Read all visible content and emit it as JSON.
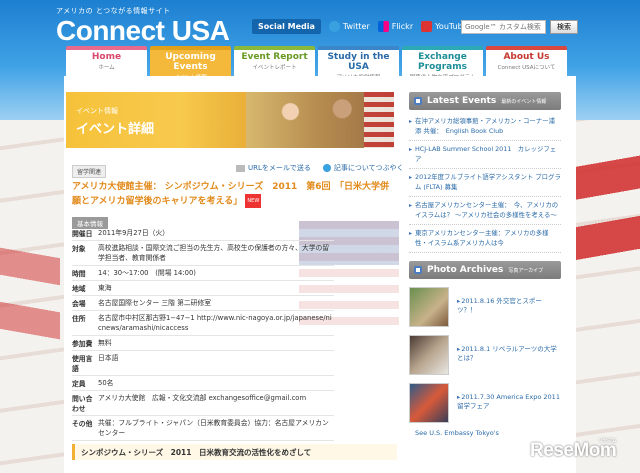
{
  "header": {
    "tagline": "アメリカの   とつながる情報サイト",
    "logo": "Connect USA"
  },
  "social": {
    "label": "Social Media",
    "twitter": "Twitter",
    "flickr": "Flickr",
    "youtube": "YouTube"
  },
  "search": {
    "placeholder": "Google™ カスタム検索",
    "button": "検索"
  },
  "nav": [
    {
      "title": "Home",
      "sub": "ホーム"
    },
    {
      "title": "Upcoming Events",
      "sub": "イベント情報"
    },
    {
      "title": "Event Report",
      "sub": "イベントレポート"
    },
    {
      "title": "Study in the USA",
      "sub": "アメリカ留学情報"
    },
    {
      "title": "Exchange Programs",
      "sub": "国務省人物交流プログラム"
    },
    {
      "title": "About Us",
      "sub": "Connect USAについて"
    }
  ],
  "banner": {
    "small": "イベント情報",
    "big": "イベント詳細"
  },
  "share": {
    "mail": "URLをメールで送る",
    "tweet": "記事についてつぶやく"
  },
  "article": {
    "category": "留学関連",
    "title": "アメリカ大使館主催： シンポジウム・シリーズ　2011　第6回　「日米大学併願とアメリカ留学後のキャリアを考える」",
    "new_badge": "NEW",
    "info_heading": "基本情報",
    "info": [
      {
        "k": "開催日",
        "v": "2011年9月27日（火）"
      },
      {
        "k": "対象",
        "v": "高校進路相談・国際交流ご担当の先生方、高校生の保護者の方々、大学の留学担当者、教育関係者"
      },
      {
        "k": "時間",
        "v": "14：30〜17:00　(開場 14:00)"
      },
      {
        "k": "地域",
        "v": "東海"
      },
      {
        "k": "会場",
        "v": "名古屋国際センター 三階 第二研修室"
      },
      {
        "k": "住所",
        "v": "名古屋市中村区那古野1−47−1 http://www.nic-nagoya.or.jp/japanese/nicnews/aramashi/nicaccess"
      },
      {
        "k": "参加費",
        "v": "無料"
      },
      {
        "k": "使用言語",
        "v": "日本語"
      },
      {
        "k": "定員",
        "v": "50名"
      },
      {
        "k": "問い合わせ",
        "v": "アメリカ大使館　広報・文化交流部 exchangesoffice@gmail.com"
      },
      {
        "k": "その他",
        "v": "共催：フルブライト・ジャパン（日米教育委員会）協力：名古屋アメリカンセンター"
      }
    ],
    "section": "シンポジウム・シリーズ　2011　日米教育交流の活性化をめざして"
  },
  "latest": {
    "title": "Latest Events",
    "sub": "最新のイベント情報",
    "items": [
      "在沖アメリカ総領事館・アメリカン・コーナー浦添 共催：　English Book Club",
      "HCJ-LAB Summer School 2011　カレッジフェア",
      "2012年度フルブライト語学アシスタント プログラム (FLTA) 募集",
      "名古屋アメリカンセンター主催：　今、アメリカのイスラムは？ 〜アメリカ社会の多様性を考える〜",
      "東京アメリカンセンター主催：アメリカの多様性・イスラム系アメリカ人は今"
    ]
  },
  "photos": {
    "title": "Photo Archives",
    "sub": "写真アーカイブ",
    "items": [
      "2011.8.16 外交官とスポーツ？！",
      "2011.8.1 リベラルアーツの大学とは？",
      "2011.7.30 America Expo 2011 留学フェア"
    ],
    "more": "See U.S. Embassy Tokyo's"
  },
  "watermark": {
    "brand": "ReseMom",
    "sub": "リセマム"
  }
}
